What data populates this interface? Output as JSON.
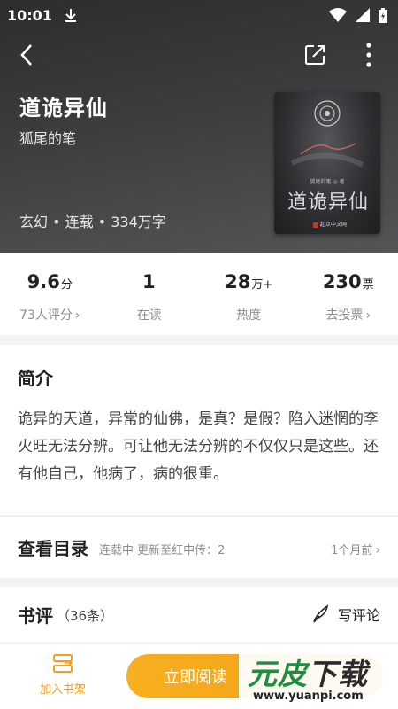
{
  "status": {
    "time": "10:01"
  },
  "book": {
    "title": "道诡异仙",
    "author": "狐尾的笔",
    "meta": "玄幻 • 连载 • 334万字",
    "cover": {
      "title": "道诡异仙",
      "author": "狐尾的笔 ◎ 著",
      "publisher": "起点中文网"
    }
  },
  "stats": [
    {
      "value": "9.6",
      "unit": "分",
      "label": "73人评分",
      "chevron": true
    },
    {
      "value": "1",
      "unit": "",
      "label": "在读",
      "chevron": false
    },
    {
      "value": "28",
      "unit": "万+",
      "label": "热度",
      "chevron": false
    },
    {
      "value": "230",
      "unit": "票",
      "label": "去投票",
      "chevron": true
    }
  ],
  "intro": {
    "title": "简介",
    "text": "诡异的天道，异常的仙佛，是真？是假？陷入迷惘的李火旺无法分辨。可让他无法分辨的不仅仅只是这些。还有他自己，他病了，病的很重。"
  },
  "catalog": {
    "title": "查看目录",
    "status": "连载中 更新至红中传：2",
    "time": "1个月前"
  },
  "reviews": {
    "title": "书评",
    "count": "（36条）",
    "write": "写评论"
  },
  "bottom": {
    "shelf": "加入书架",
    "read": "立即阅读"
  },
  "watermark": {
    "main_a": "元",
    "main_b": "皮",
    "main_c": "下载",
    "url": "www.yuanpi.com"
  },
  "colors": {
    "accent": "#f5a51c",
    "header_bg": "#3a393b",
    "watermark_green": "#1d8f3e"
  }
}
